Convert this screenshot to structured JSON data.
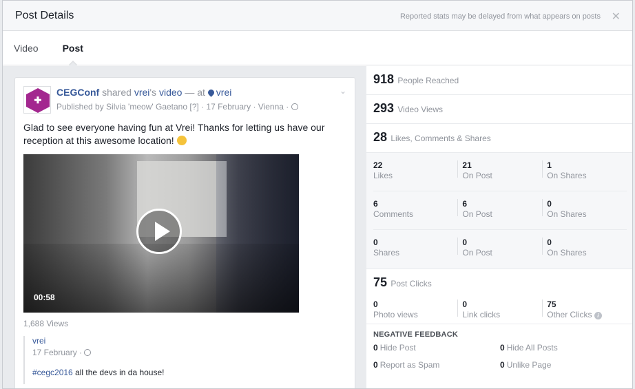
{
  "header": {
    "title": "Post Details",
    "note": "Reported stats may be delayed from what appears on posts",
    "close_icon": "close-icon",
    "close_glyph": "✕"
  },
  "tabs": [
    {
      "label": "Video",
      "active": false
    },
    {
      "label": "Post",
      "active": true
    }
  ],
  "post": {
    "page_name": "CEGConf",
    "shared_text": "shared",
    "owner_name": "vrei",
    "owner_suffix": "'s",
    "video_word": "video",
    "at_text": "— at",
    "location": "vrei",
    "published_by": "Published by Silvia 'meow' Gaetano",
    "help_marker": "[?]",
    "date": "17 February",
    "city": "Vienna",
    "separator": "·",
    "chevron": "⌄",
    "text": "Glad to see everyone having fun at Vrei! Thanks for letting us have our reception at this awesome location!",
    "video": {
      "duration": "00:58"
    },
    "views": "1,688 Views",
    "shared_post": {
      "name": "vrei",
      "date": "17 February ·",
      "hashtag": "#cegc2016",
      "message": "all the devs in da house!"
    }
  },
  "stats": {
    "people_reached": {
      "value": "918",
      "label": "People Reached"
    },
    "video_views": {
      "value": "293",
      "label": "Video Views"
    },
    "engagement": {
      "value": "28",
      "label": "Likes, Comments & Shares"
    },
    "grid": [
      [
        {
          "value": "22",
          "label": "Likes"
        },
        {
          "value": "21",
          "label": "On Post"
        },
        {
          "value": "1",
          "label": "On Shares"
        }
      ],
      [
        {
          "value": "6",
          "label": "Comments"
        },
        {
          "value": "6",
          "label": "On Post"
        },
        {
          "value": "0",
          "label": "On Shares"
        }
      ],
      [
        {
          "value": "0",
          "label": "Shares"
        },
        {
          "value": "0",
          "label": "On Post"
        },
        {
          "value": "0",
          "label": "On Shares"
        }
      ]
    ],
    "post_clicks": {
      "value": "75",
      "label": "Post Clicks"
    },
    "clicks": [
      {
        "value": "0",
        "label": "Photo views"
      },
      {
        "value": "0",
        "label": "Link clicks"
      },
      {
        "value": "75",
        "label": "Other Clicks"
      }
    ],
    "info_glyph": "i",
    "negative_title": "NEGATIVE FEEDBACK",
    "negative": [
      {
        "value": "0",
        "label": "Hide Post"
      },
      {
        "value": "0",
        "label": "Hide All Posts"
      },
      {
        "value": "0",
        "label": "Report as Spam"
      },
      {
        "value": "0",
        "label": "Unlike Page"
      }
    ]
  }
}
